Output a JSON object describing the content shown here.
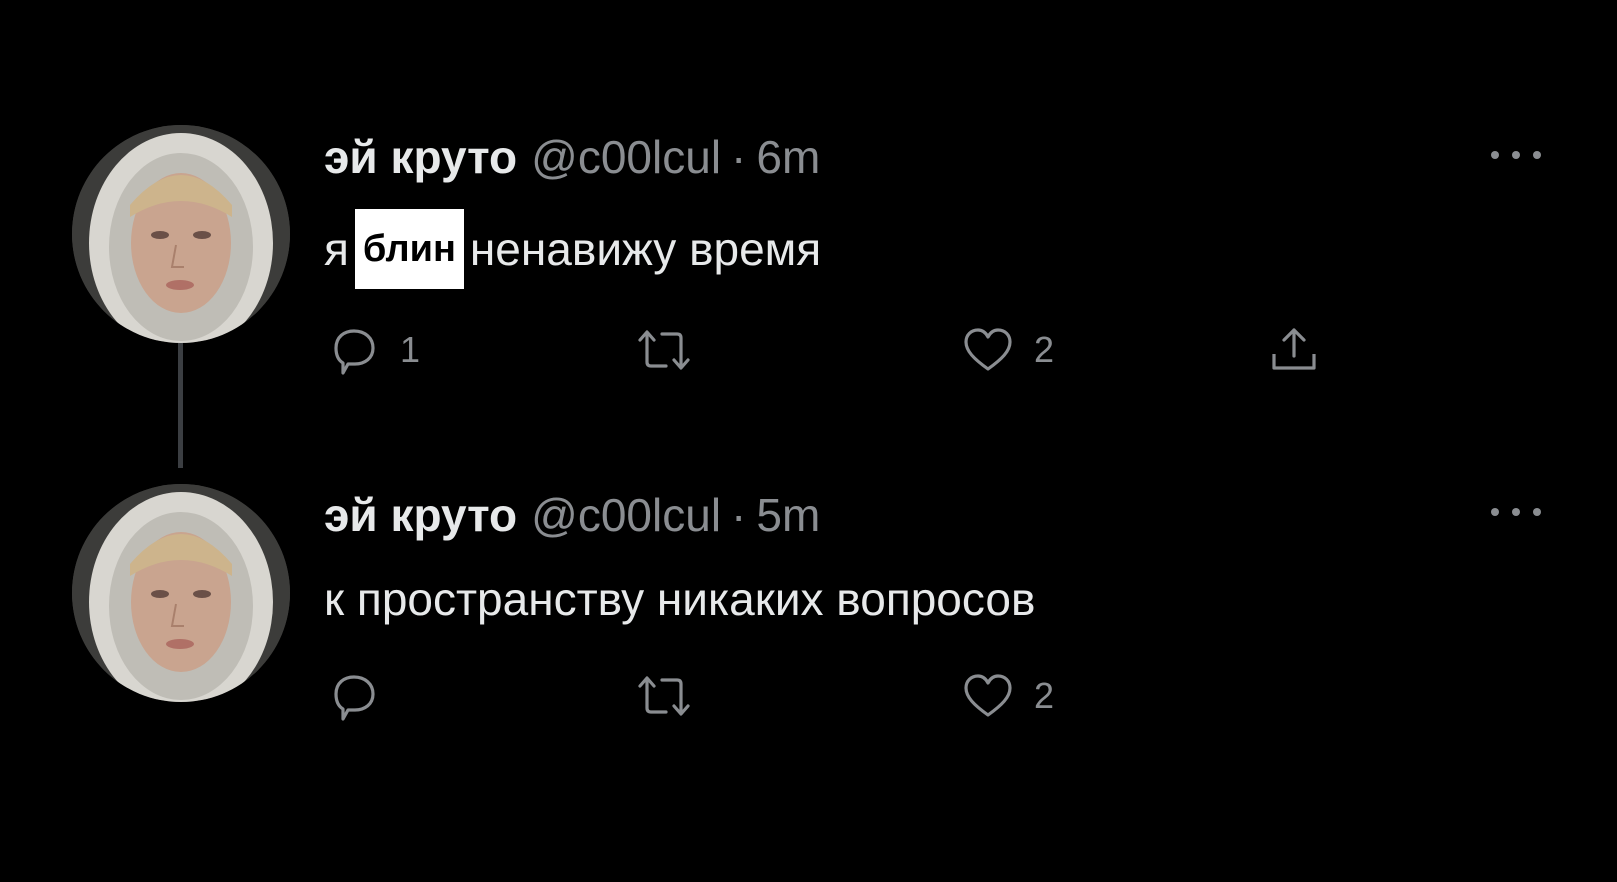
{
  "tweets": [
    {
      "display_name": "эй круто",
      "handle": "@c00lcul",
      "separator": "·",
      "time": "6m",
      "text_before": "я",
      "censored_word": "блин",
      "text_after": "ненавижу время",
      "reply_count": "1",
      "like_count": "2"
    },
    {
      "display_name": "эй круто",
      "handle": "@c00lcul",
      "separator": "·",
      "time": "5m",
      "text": "к пространству никаких вопросов",
      "reply_count": "",
      "like_count": "2"
    }
  ],
  "icons": {
    "avatar": "avatar-photo",
    "more": "more-dots-icon",
    "reply": "reply-icon",
    "retweet": "retweet-icon",
    "like": "heart-icon",
    "share": "share-icon"
  },
  "colors": {
    "background": "#000000",
    "primary_text": "#e7e9ea",
    "secondary_text": "#8a8d91",
    "thread_line": "#3b3e42"
  }
}
